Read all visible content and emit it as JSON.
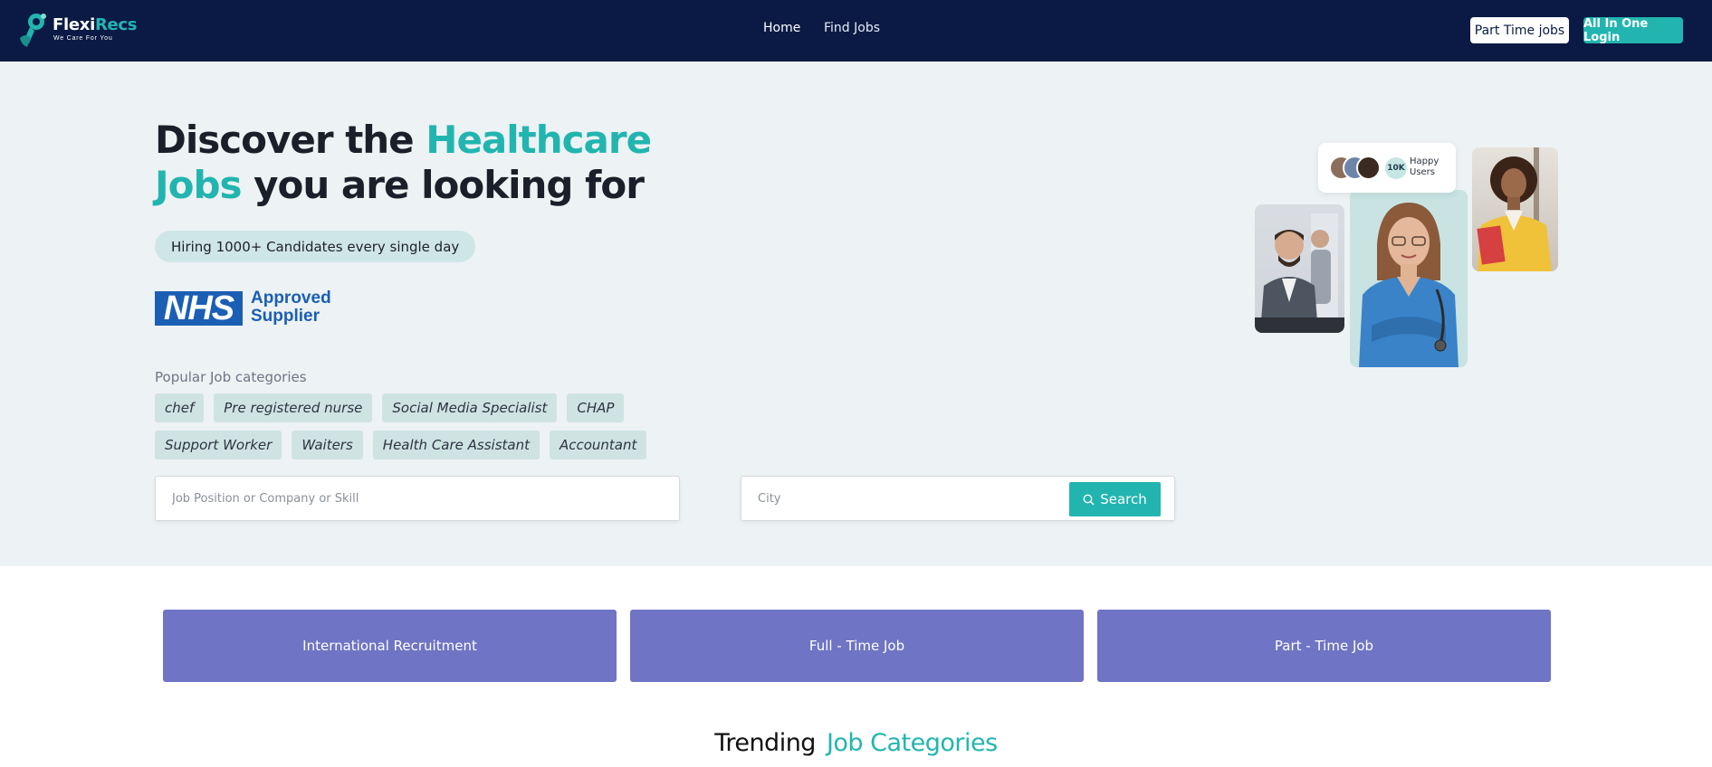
{
  "brand": {
    "name_part1": "Flexi",
    "name_part2": "Recs",
    "tagline": "We Care For You",
    "accent_color": "#22b5b0",
    "nav_bg_color": "#0a1a44"
  },
  "nav": {
    "links": [
      "Home",
      "Find Jobs"
    ],
    "part_time_button": "Part Time jobs",
    "login_button": "All In One Login"
  },
  "hero": {
    "title_part1": "Discover the ",
    "title_highlight1": "Healthcare",
    "title_highlight2": "Jobs",
    "title_part2": " you are looking for",
    "hiring_pill": "Hiring 1000+ Candidates every single day",
    "nhs_logo": "NHS",
    "nhs_line1": "Approved",
    "nhs_line2": "Supplier",
    "happy_count": "10K",
    "happy_line1": "Happy",
    "happy_line2": "Users"
  },
  "popular": {
    "title": "Popular Job categories",
    "row1": [
      "chef",
      "Pre registered nurse",
      "Social Media Specialist",
      "CHAP"
    ],
    "row2": [
      "Support Worker",
      "Waiters",
      "Health Care Assistant",
      "Accountant"
    ]
  },
  "search": {
    "job_placeholder": "Job Position or Company or Skill",
    "city_placeholder": "City",
    "button_label": "Search"
  },
  "categories": {
    "card1": "International Recruitment",
    "card2": "Full - Time Job",
    "card3": "Part - Time Job",
    "card_color": "#6f74c4"
  },
  "trending": {
    "part1": "Trending",
    "part2": "Job Categories"
  }
}
